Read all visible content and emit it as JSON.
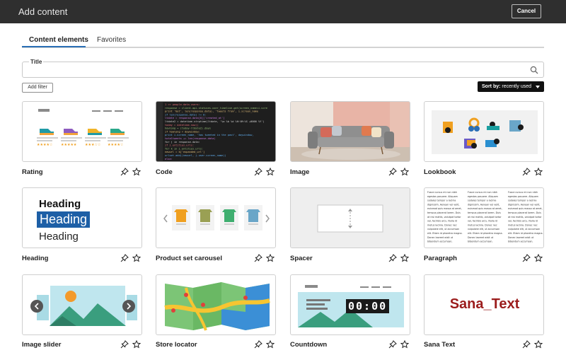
{
  "header": {
    "title": "Add content",
    "cancel_label": "Cancel"
  },
  "tabs": [
    {
      "label": "Content elements",
      "active": true
    },
    {
      "label": "Favorites",
      "active": false
    }
  ],
  "search": {
    "label": "Title",
    "value": ""
  },
  "filter": {
    "add_label": "Add filter"
  },
  "sort": {
    "prefix": "Sort by:",
    "value": "recently used"
  },
  "colors": {
    "topbar": "#2f2f2f",
    "accent": "#2a6fb6",
    "sana_text": "#9b1c1c"
  },
  "elements": [
    {
      "label": "Rating"
    },
    {
      "label": "Code"
    },
    {
      "label": "Image"
    },
    {
      "label": "Lookbook"
    },
    {
      "label": "Heading"
    },
    {
      "label": "Product set carousel"
    },
    {
      "label": "Spacer"
    },
    {
      "label": "Paragraph"
    },
    {
      "label": "Image slider"
    },
    {
      "label": "Store locator"
    },
    {
      "label": "Countdown"
    },
    {
      "label": "Sana Text"
    }
  ],
  "previews": {
    "heading_lines": [
      "Heading",
      "Heading",
      "Heading"
    ],
    "countdown_value": "00:00",
    "sana_text": "Sana_Text",
    "code_lines": [
      "1 >> people.data.users:",
      "response = client.api.statuses.user_timeline.get(screen_name=i.scre",
      "print 'Got', len(response.data), 'tweets from', i.screen_name",
      "if len(response.data) != 0:",
      "  ltdate = response.data[0]['created_at']",
      "  ltdate2 = datetime.strptime(ltdate, '%a %b %d %H:%M:%S +0000 %Y')",
      "  today = datetime.now()",
      "  howlong = (today-ltdate2).days",
      "  if howlong < daywindow:",
      "    print i.screen_name, 'has tweeted in the past', daywindow,",
      "    totaltweets += len(response.data)",
      "    for j in response.data:",
      "      if j.entities.urls:",
      "        for k in j.entities.urls:",
      "          newurl = k['expanded_url']",
      "          urlset.add((newurl, j.user.screen_name))",
      "else:"
    ],
    "paragraph_cols": [
      [
        "Fusce cursus mi non nibh",
        "egestas posuere. Aliquam",
        "sodales tempor a lacinia",
        "dignissim. Aenean vel velit,",
        "euismod quis massa at amet,",
        "tempus placerat lorem. Duis",
        "at nisi mattis, volutpat tortor",
        "vel, facilisis arcu. Nulla id",
        "metus lacinia. Donec nec",
        "vulputate elit, ut accumsan",
        "elit. Etiam id pharetra magna.",
        "Donec laoreet wisit ut",
        "bibendum accumsan."
      ],
      [
        "Fusce cursus mi non nibh",
        "egestas posuere. Aliquam",
        "sodales tempor a lacinia",
        "dignissim. Aenean vel velit,",
        "euismod quis massa at amet,",
        "tempus placerat lorem. Duis",
        "at nisi mattis, volutpat tortor",
        "vel, facilisis arcu. Nulla id",
        "metus lacinia. Donec nec",
        "vulputate elit, ut accumsan",
        "elit. Etiam id pharetra magna.",
        "Donec laoreet wisit ut",
        "bibendum accumsan."
      ],
      [
        "Fusce cursus mi non nibh",
        "egestas posuere. Aliquam",
        "sodales tempor a lacinia",
        "dignissim. Aenean vel velit,",
        "euismod quis massa at amet,",
        "tempus placerat lorem. Duis",
        "at nisi mattis, volutpat tortor",
        "vel, facilisis arcu. Nulla id",
        "metus lacinia. Donec nec",
        "vulputate elit, ut accumsan",
        "elit. Etiam id pharetra magna.",
        "Donec laoreet wisit ut",
        "bibendum accumsan."
      ]
    ]
  }
}
